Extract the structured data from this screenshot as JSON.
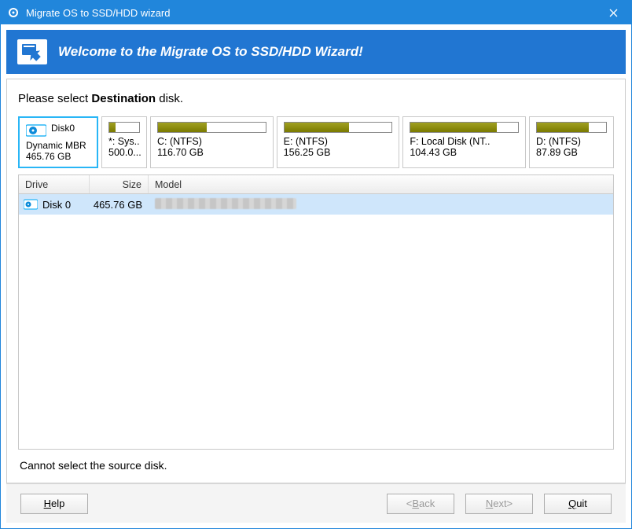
{
  "titlebar": {
    "title": "Migrate OS to SSD/HDD wizard"
  },
  "banner": {
    "text": "Welcome to the Migrate OS to SSD/HDD Wizard!"
  },
  "prompt_prefix": "Please select ",
  "prompt_bold": "Destination",
  "prompt_suffix": " disk.",
  "disk0": {
    "name": "Disk0",
    "type": "Dynamic MBR",
    "size": "465.76 GB"
  },
  "volumes": [
    {
      "label": "*: Sys..",
      "size": "500.0...",
      "fill": 22
    },
    {
      "label": "C: (NTFS)",
      "size": "116.70 GB",
      "fill": 45
    },
    {
      "label": "E: (NTFS)",
      "size": "156.25 GB",
      "fill": 60
    },
    {
      "label": "F: Local Disk (NT..",
      "size": "104.43 GB",
      "fill": 80
    },
    {
      "label": "D: (NTFS)",
      "size": "87.89 GB",
      "fill": 75
    }
  ],
  "grid": {
    "headers": {
      "drive": "Drive",
      "size": "Size",
      "model": "Model"
    },
    "rows": [
      {
        "drive": "Disk 0",
        "size": "465.76 GB",
        "model_blurred": true
      }
    ]
  },
  "note": "Cannot select the source disk.",
  "buttons": {
    "help": "Help",
    "back": "<Back",
    "next": "Next>",
    "quit": "Quit"
  }
}
